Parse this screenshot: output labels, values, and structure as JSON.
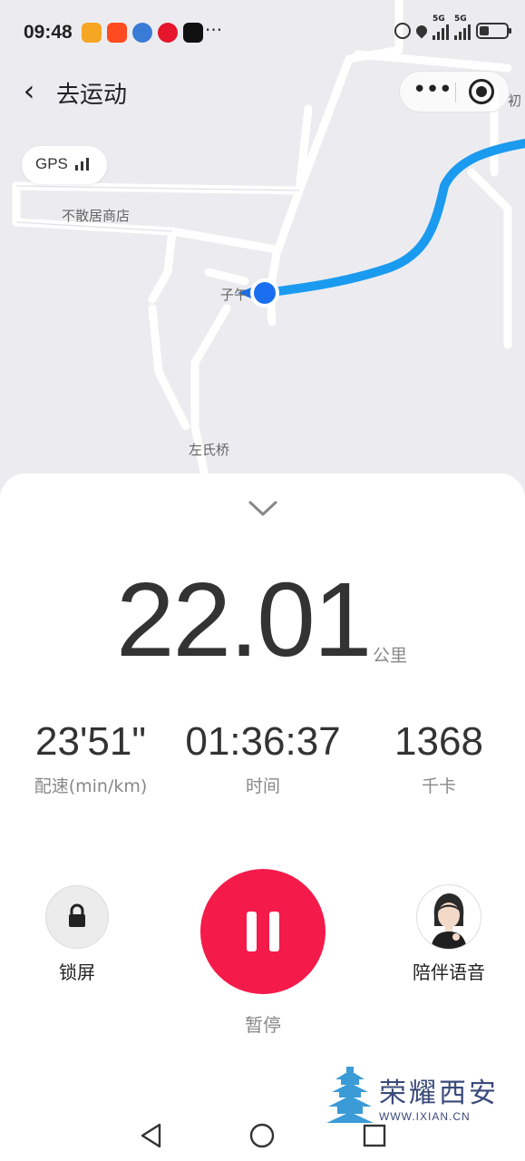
{
  "status_bar": {
    "time": "09:48",
    "more": "···",
    "net_label_1": "5G",
    "net_label_2": "5G",
    "battery_level": 0.35,
    "app_icons": [
      "love-app-icon",
      "taobao-app-icon",
      "browser-app-icon",
      "weibo-app-icon",
      "douyin-app-icon"
    ]
  },
  "nav": {
    "back_icon": "chevron-left-icon",
    "title": "去运动",
    "menu_label": "•••",
    "close_icon": "target-icon"
  },
  "map": {
    "gps_label": "GPS",
    "gps_signal_bars": 3,
    "labels": {
      "shop": "不散居商店",
      "poi": "子午",
      "bridge": "左氏桥",
      "edge": "初"
    },
    "route_color": "#1a9bf0",
    "location_color": "#1a6ff0"
  },
  "workout": {
    "collapse_icon": "chevron-down-icon",
    "distance_value": "22.01",
    "distance_unit": "公里",
    "stats": [
      {
        "value": "23'51\"",
        "label": "配速(min/km)"
      },
      {
        "value": "01:36:37",
        "label": "时间"
      },
      {
        "value": "1368",
        "label": "千卡"
      }
    ],
    "lock_label": "锁屏",
    "pause_label": "暂停",
    "voice_label": "陪伴语音",
    "pause_color": "#f41a4a"
  },
  "watermark": {
    "text": "荣耀西安",
    "url": "WWW.IXIAN.CN"
  },
  "system_nav": [
    "back-triangle-icon",
    "home-circle-icon",
    "recents-square-icon"
  ]
}
